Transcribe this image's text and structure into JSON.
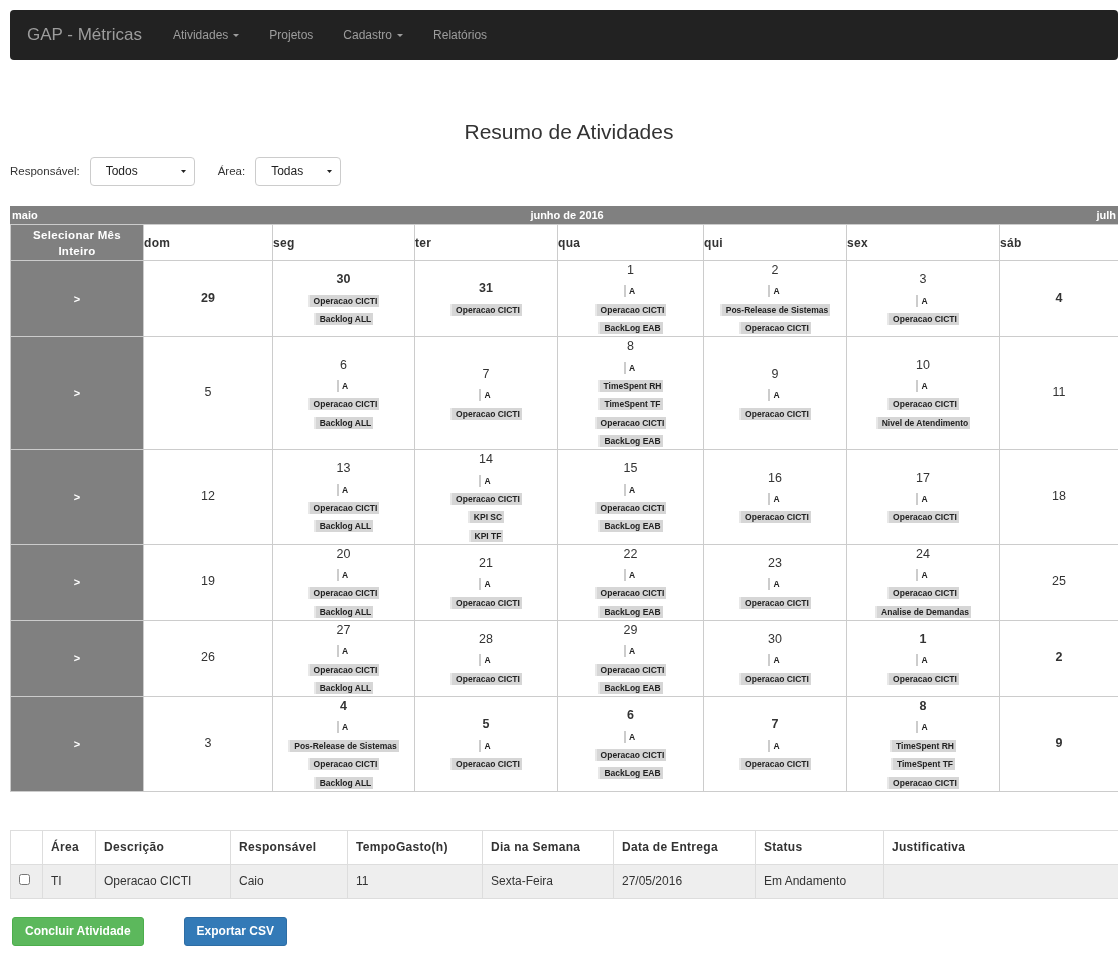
{
  "navbar": {
    "brand": "GAP - Métricas",
    "items": [
      {
        "label": "Atividades",
        "dropdown": true
      },
      {
        "label": "Projetos",
        "dropdown": false
      },
      {
        "label": "Cadastro",
        "dropdown": true
      },
      {
        "label": "Relatórios",
        "dropdown": false
      }
    ]
  },
  "title": "Resumo de Atividades",
  "filters": [
    {
      "label": "Responsável:",
      "value": "Todos"
    },
    {
      "label": "Área:",
      "value": "Todas"
    }
  ],
  "calendar": {
    "prev_month": "maio",
    "month": "junho de 2016",
    "next_month": "julh",
    "select_all": "Selecionar Mês Inteiro",
    "weekdays": [
      "dom",
      "seg",
      "ter",
      "qua",
      "qui",
      "sex",
      "sáb"
    ],
    "weeks": [
      {
        "select": ">",
        "days": [
          {
            "day": "29",
            "bold": true
          },
          {
            "day": "30",
            "bold": true,
            "events": [
              {
                "text": "Operacao CICTI",
                "kind": "tag"
              },
              {
                "text": "Backlog ALL",
                "kind": "tag"
              }
            ]
          },
          {
            "day": "31",
            "bold": true,
            "events": [
              {
                "text": "Operacao CICTI",
                "kind": "tag"
              }
            ]
          },
          {
            "day": "1",
            "bold": false,
            "events": [
              {
                "text": "A",
                "kind": "plain"
              },
              {
                "text": "Operacao CICTI",
                "kind": "tag"
              },
              {
                "text": "BackLog EAB",
                "kind": "tag"
              }
            ]
          },
          {
            "day": "2",
            "bold": false,
            "events": [
              {
                "text": "A",
                "kind": "plain"
              },
              {
                "text": "Pos-Release de Sistemas",
                "kind": "tag"
              },
              {
                "text": "Operacao CICTI",
                "kind": "tag"
              }
            ]
          },
          {
            "day": "3",
            "bold": false,
            "events": [
              {
                "text": "A",
                "kind": "plain"
              },
              {
                "text": "Operacao CICTI",
                "kind": "tag"
              }
            ]
          },
          {
            "day": "4",
            "bold": true
          }
        ]
      },
      {
        "select": ">",
        "days": [
          {
            "day": "5",
            "bold": false
          },
          {
            "day": "6",
            "bold": false,
            "events": [
              {
                "text": "A",
                "kind": "plain"
              },
              {
                "text": "Operacao CICTI",
                "kind": "tag"
              },
              {
                "text": "Backlog ALL",
                "kind": "tag"
              }
            ]
          },
          {
            "day": "7",
            "bold": false,
            "events": [
              {
                "text": "A",
                "kind": "plain"
              },
              {
                "text": "Operacao CICTI",
                "kind": "tag"
              }
            ]
          },
          {
            "day": "8",
            "bold": false,
            "events": [
              {
                "text": "A",
                "kind": "plain"
              },
              {
                "text": "TimeSpent RH",
                "kind": "tag"
              },
              {
                "text": "TimeSpent TF",
                "kind": "tag"
              },
              {
                "text": "Operacao CICTI",
                "kind": "tag"
              },
              {
                "text": "BackLog EAB",
                "kind": "tag"
              }
            ]
          },
          {
            "day": "9",
            "bold": false,
            "events": [
              {
                "text": "A",
                "kind": "plain"
              },
              {
                "text": "Operacao CICTI",
                "kind": "tag"
              }
            ]
          },
          {
            "day": "10",
            "bold": false,
            "events": [
              {
                "text": "A",
                "kind": "plain"
              },
              {
                "text": "Operacao CICTI",
                "kind": "tag"
              },
              {
                "text": "Nivel de Atendimento",
                "kind": "tag"
              }
            ]
          },
          {
            "day": "11",
            "bold": false
          }
        ]
      },
      {
        "select": ">",
        "days": [
          {
            "day": "12",
            "bold": false
          },
          {
            "day": "13",
            "bold": false,
            "events": [
              {
                "text": "A",
                "kind": "plain"
              },
              {
                "text": "Operacao CICTI",
                "kind": "tag"
              },
              {
                "text": "Backlog ALL",
                "kind": "tag"
              }
            ]
          },
          {
            "day": "14",
            "bold": false,
            "events": [
              {
                "text": "A",
                "kind": "plain"
              },
              {
                "text": "Operacao CICTI",
                "kind": "tag"
              },
              {
                "text": "KPI SC",
                "kind": "tag"
              },
              {
                "text": "KPI TF",
                "kind": "tag"
              }
            ]
          },
          {
            "day": "15",
            "bold": false,
            "events": [
              {
                "text": "A",
                "kind": "plain"
              },
              {
                "text": "Operacao CICTI",
                "kind": "tag"
              },
              {
                "text": "BackLog EAB",
                "kind": "tag"
              }
            ]
          },
          {
            "day": "16",
            "bold": false,
            "events": [
              {
                "text": "A",
                "kind": "plain"
              },
              {
                "text": "Operacao CICTI",
                "kind": "tag"
              }
            ]
          },
          {
            "day": "17",
            "bold": false,
            "events": [
              {
                "text": "A",
                "kind": "plain"
              },
              {
                "text": "Operacao CICTI",
                "kind": "tag"
              }
            ]
          },
          {
            "day": "18",
            "bold": false
          }
        ]
      },
      {
        "select": ">",
        "days": [
          {
            "day": "19",
            "bold": false
          },
          {
            "day": "20",
            "bold": false,
            "events": [
              {
                "text": "A",
                "kind": "plain"
              },
              {
                "text": "Operacao CICTI",
                "kind": "tag"
              },
              {
                "text": "Backlog ALL",
                "kind": "tag"
              }
            ]
          },
          {
            "day": "21",
            "bold": false,
            "events": [
              {
                "text": "A",
                "kind": "plain"
              },
              {
                "text": "Operacao CICTI",
                "kind": "tag"
              }
            ]
          },
          {
            "day": "22",
            "bold": false,
            "events": [
              {
                "text": "A",
                "kind": "plain"
              },
              {
                "text": "Operacao CICTI",
                "kind": "tag"
              },
              {
                "text": "BackLog EAB",
                "kind": "tag"
              }
            ]
          },
          {
            "day": "23",
            "bold": false,
            "events": [
              {
                "text": "A",
                "kind": "plain"
              },
              {
                "text": "Operacao CICTI",
                "kind": "tag"
              }
            ]
          },
          {
            "day": "24",
            "bold": false,
            "events": [
              {
                "text": "A",
                "kind": "plain"
              },
              {
                "text": "Operacao CICTI",
                "kind": "tag"
              },
              {
                "text": "Analise de Demandas",
                "kind": "tag"
              }
            ]
          },
          {
            "day": "25",
            "bold": false
          }
        ]
      },
      {
        "select": ">",
        "days": [
          {
            "day": "26",
            "bold": false
          },
          {
            "day": "27",
            "bold": false,
            "events": [
              {
                "text": "A",
                "kind": "plain"
              },
              {
                "text": "Operacao CICTI",
                "kind": "tag"
              },
              {
                "text": "Backlog ALL",
                "kind": "tag"
              }
            ]
          },
          {
            "day": "28",
            "bold": false,
            "events": [
              {
                "text": "A",
                "kind": "plain"
              },
              {
                "text": "Operacao CICTI",
                "kind": "tag"
              }
            ]
          },
          {
            "day": "29",
            "bold": false,
            "events": [
              {
                "text": "A",
                "kind": "plain"
              },
              {
                "text": "Operacao CICTI",
                "kind": "tag"
              },
              {
                "text": "BackLog EAB",
                "kind": "tag"
              }
            ]
          },
          {
            "day": "30",
            "bold": false,
            "events": [
              {
                "text": "A",
                "kind": "plain"
              },
              {
                "text": "Operacao CICTI",
                "kind": "tag"
              }
            ]
          },
          {
            "day": "1",
            "bold": true,
            "events": [
              {
                "text": "A",
                "kind": "plain"
              },
              {
                "text": "Operacao CICTI",
                "kind": "tag"
              }
            ]
          },
          {
            "day": "2",
            "bold": true
          }
        ]
      },
      {
        "select": ">",
        "days": [
          {
            "day": "3",
            "bold": false
          },
          {
            "day": "4",
            "bold": true,
            "events": [
              {
                "text": "A",
                "kind": "plain"
              },
              {
                "text": "Pos-Release de Sistemas",
                "kind": "tag"
              },
              {
                "text": "Operacao CICTI",
                "kind": "tag"
              },
              {
                "text": "Backlog ALL",
                "kind": "tag"
              }
            ]
          },
          {
            "day": "5",
            "bold": true,
            "events": [
              {
                "text": "A",
                "kind": "plain"
              },
              {
                "text": "Operacao CICTI",
                "kind": "tag"
              }
            ]
          },
          {
            "day": "6",
            "bold": true,
            "events": [
              {
                "text": "A",
                "kind": "plain"
              },
              {
                "text": "Operacao CICTI",
                "kind": "tag"
              },
              {
                "text": "BackLog EAB",
                "kind": "tag"
              }
            ]
          },
          {
            "day": "7",
            "bold": true,
            "events": [
              {
                "text": "A",
                "kind": "plain"
              },
              {
                "text": "Operacao CICTI",
                "kind": "tag"
              }
            ]
          },
          {
            "day": "8",
            "bold": true,
            "events": [
              {
                "text": "A",
                "kind": "plain"
              },
              {
                "text": "TimeSpent RH",
                "kind": "tag"
              },
              {
                "text": "TimeSpent TF",
                "kind": "tag"
              },
              {
                "text": "Operacao CICTI",
                "kind": "tag"
              }
            ]
          },
          {
            "day": "9",
            "bold": true
          }
        ]
      }
    ]
  },
  "table": {
    "columns": [
      "Área",
      "Descrição",
      "Responsável",
      "TempoGasto(h)",
      "Dia na Semana",
      "Data de Entrega",
      "Status",
      "Justificativa"
    ],
    "rows": [
      {
        "checked": false,
        "cells": [
          "TI",
          "Operacao CICTI",
          "Caio",
          "11",
          "Sexta-Feira",
          "27/05/2016",
          "Em Andamento"
        ]
      }
    ]
  },
  "buttons": [
    {
      "label": "Concluir Atividade",
      "kind": "success"
    },
    {
      "label": "Exportar CSV",
      "kind": "primary"
    }
  ]
}
